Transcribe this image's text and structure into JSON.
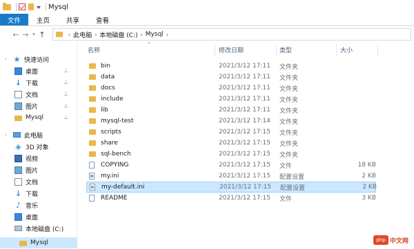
{
  "titlebar": {
    "title": "Mysql"
  },
  "ribbon": {
    "tabs": [
      "文件",
      "主页",
      "共享",
      "查看"
    ]
  },
  "address": {
    "crumbs": [
      "此电脑",
      "本地磁盘 (C:)",
      "Mysql"
    ]
  },
  "sidebar": {
    "items": [
      {
        "label": "快速访问",
        "icon": "star-icon"
      },
      {
        "label": "桌面",
        "icon": "desktop-icon",
        "pinned": true
      },
      {
        "label": "下载",
        "icon": "download-icon",
        "pinned": true
      },
      {
        "label": "文档",
        "icon": "document-icon",
        "pinned": true
      },
      {
        "label": "图片",
        "icon": "picture-icon",
        "pinned": true
      },
      {
        "label": "Mysql",
        "icon": "folder-icon",
        "pinned": true
      },
      {
        "label": "此电脑",
        "icon": "computer-icon"
      },
      {
        "label": "3D 对象",
        "icon": "3d-objects-icon"
      },
      {
        "label": "视频",
        "icon": "video-icon"
      },
      {
        "label": "图片",
        "icon": "picture-icon"
      },
      {
        "label": "文档",
        "icon": "document-icon"
      },
      {
        "label": "下载",
        "icon": "download-icon"
      },
      {
        "label": "音乐",
        "icon": "music-icon"
      },
      {
        "label": "桌面",
        "icon": "desktop-icon"
      },
      {
        "label": "本地磁盘 (C:)",
        "icon": "drive-icon"
      },
      {
        "label": "Mysql",
        "icon": "folder-icon",
        "selected": true
      }
    ]
  },
  "columns": {
    "name": "名称",
    "date": "修改日期",
    "type": "类型",
    "size": "大小"
  },
  "files": [
    {
      "name": "bin",
      "date": "2021/3/12 17:11",
      "type": "文件夹",
      "size": "",
      "kind": "folder"
    },
    {
      "name": "data",
      "date": "2021/3/12 17:11",
      "type": "文件夹",
      "size": "",
      "kind": "folder"
    },
    {
      "name": "docs",
      "date": "2021/3/12 17:11",
      "type": "文件夹",
      "size": "",
      "kind": "folder"
    },
    {
      "name": "include",
      "date": "2021/3/12 17:11",
      "type": "文件夹",
      "size": "",
      "kind": "folder"
    },
    {
      "name": "lib",
      "date": "2021/3/12 17:11",
      "type": "文件夹",
      "size": "",
      "kind": "folder"
    },
    {
      "name": "mysql-test",
      "date": "2021/3/12 17:14",
      "type": "文件夹",
      "size": "",
      "kind": "folder"
    },
    {
      "name": "scripts",
      "date": "2021/3/12 17:15",
      "type": "文件夹",
      "size": "",
      "kind": "folder"
    },
    {
      "name": "share",
      "date": "2021/3/12 17:15",
      "type": "文件夹",
      "size": "",
      "kind": "folder"
    },
    {
      "name": "sql-bench",
      "date": "2021/3/12 17:15",
      "type": "文件夹",
      "size": "",
      "kind": "folder"
    },
    {
      "name": "COPYING",
      "date": "2021/3/12 17:15",
      "type": "文件",
      "size": "18 KB",
      "kind": "file"
    },
    {
      "name": "my.ini",
      "date": "2021/3/12 17:15",
      "type": "配置设置",
      "size": "2 KB",
      "kind": "ini"
    },
    {
      "name": "my-default.ini",
      "date": "2021/3/12 17:15",
      "type": "配置设置",
      "size": "2 KB",
      "kind": "ini",
      "selected": true
    },
    {
      "name": "README",
      "date": "2021/3/12 17:15",
      "type": "文件",
      "size": "3 KB",
      "kind": "file"
    }
  ],
  "watermark": {
    "logo": "php",
    "text": "中文网"
  }
}
